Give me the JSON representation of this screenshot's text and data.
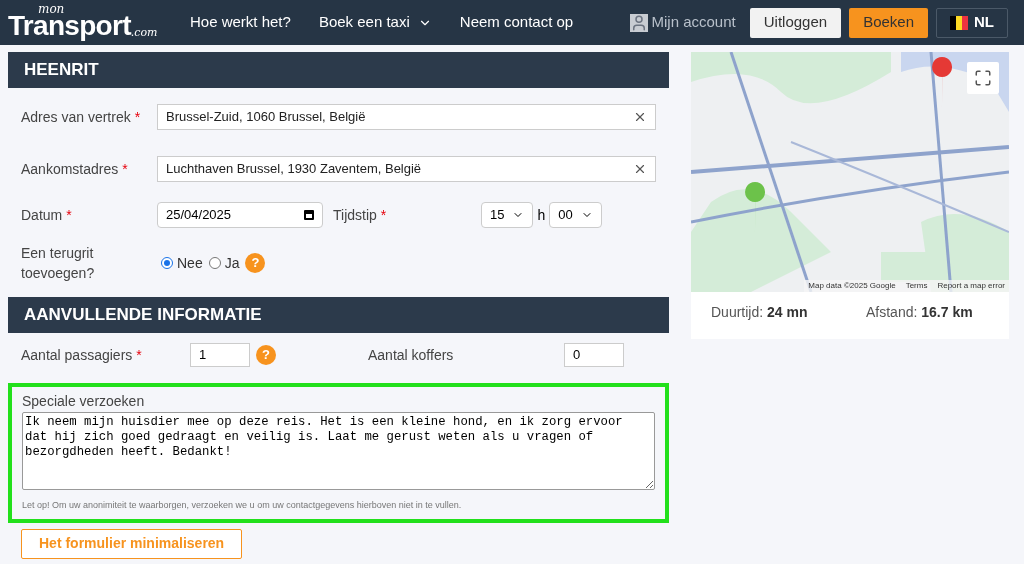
{
  "header": {
    "logo_small": "mon",
    "logo_main": "Transport",
    "logo_suffix": ".com",
    "nav": [
      {
        "label": "Hoe werkt het?",
        "dropdown": false
      },
      {
        "label": "Boek een taxi",
        "dropdown": true
      },
      {
        "label": "Neem contact op",
        "dropdown": false
      }
    ],
    "account": "Mijn account",
    "logout": "Uitloggen",
    "book": "Boeken",
    "language": "NL"
  },
  "outbound": {
    "title": "HEENRIT",
    "departure": {
      "label": "Adres van vertrek",
      "mark": "*",
      "value": "Brussel-Zuid, 1060 Brussel, België"
    },
    "arrival": {
      "label": "Aankomstadres",
      "mark": "*",
      "value": "Luchthaven Brussel, 1930 Zaventem, België"
    },
    "date": {
      "label": "Datum",
      "mark": "*",
      "value": "25/04/2025"
    },
    "time": {
      "label": "Tijdstip",
      "mark": "*",
      "hour": "15",
      "separator": "h",
      "minute": "00"
    },
    "return_trip": {
      "label": "Een terugrit toevoegen?",
      "options": [
        {
          "label": "Nee",
          "selected": true
        },
        {
          "label": "Ja",
          "selected": false
        }
      ],
      "help": "?"
    }
  },
  "additional": {
    "title": "AANVULLENDE INFORMATIE",
    "passengers": {
      "label": "Aantal passagiers",
      "mark": "*",
      "value": "1",
      "help": "?"
    },
    "suitcases": {
      "label": "Aantal koffers",
      "value": "0"
    },
    "requests": {
      "label": "Speciale verzoeken",
      "highlighted": true,
      "value": "Ik neem mijn huisdier mee op deze reis. Het is een kleine hond, en ik zorg ervoor dat hij zich goed gedraagt en veilig is. Laat me gerust weten als u vragen of bezorgdheden heeft. Bedankt!",
      "note": "Let op! Om uw anonimiteit te waarborgen, verzoeken we u om uw contactgegevens hierboven niet in te vullen."
    },
    "minimize": "Het formulier minimaliseren"
  },
  "map": {
    "kind": "picture",
    "attribution": [
      "Map data ©2025 Google",
      "Terms",
      "Report a map error"
    ],
    "duration_label": "Duurtijd:",
    "duration": "24 mn",
    "distance_label": "Afstand:",
    "distance": "16.7 km"
  }
}
